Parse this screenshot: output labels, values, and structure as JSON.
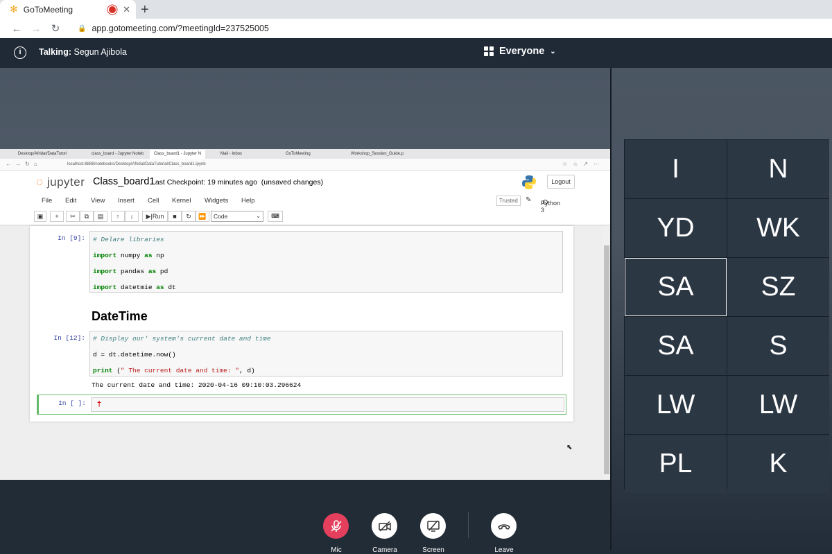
{
  "browser": {
    "tab_title": "GoToMeeting",
    "new_tab": "+",
    "url": "app.gotomeeting.com/?meetingId=237525005"
  },
  "meeting": {
    "talking_label": "Talking:",
    "talking_name": "Segun Ajibola",
    "audience": "Everyone"
  },
  "shared_screen": {
    "tabs": [
      "Desktop/Afridat/DataTutori",
      "class_board - Jupyter Noteb",
      "Class_board1 - Jupyter N",
      "Mail - Inbox",
      "GoToMeeting",
      "Workshop_Session_Guide.p"
    ],
    "url": "localhost:8888/notebooks/Desktop/Afridat/DataTutorial/Class_board1.ipynb",
    "jupyter": {
      "logo": "jupyter",
      "notebook_name": "Class_board1",
      "checkpoint": "Last Checkpoint: 19 minutes ago",
      "unsaved": "(unsaved changes)",
      "logout": "Logout",
      "menu": [
        "File",
        "Edit",
        "View",
        "Insert",
        "Cell",
        "Kernel",
        "Widgets",
        "Help"
      ],
      "trusted": "Trusted",
      "kernel": "Python 3",
      "run_label": "Run",
      "cell_type": "Code",
      "cell1": {
        "prompt": "In [9]:",
        "comment": "# Delare libraries",
        "l2_kw": "import",
        "l2_mod": " numpy ",
        "l2_as": "as",
        "l2_alias": " np",
        "l3_kw": "import",
        "l3_mod": " pandas ",
        "l3_as": "as",
        "l3_alias": " pd",
        "l4_kw": "import",
        "l4_mod": " datetmie ",
        "l4_as": "as",
        "l4_alias": " dt"
      },
      "heading": "DateTime",
      "cell2": {
        "prompt": "In [12]:",
        "comment": "# Display our' system's current date and time",
        "line2": "d = dt.datetime.now()",
        "print_kw": "print",
        "print_open": " (",
        "print_str": "\" The current date and time: \"",
        "print_rest": ", d)"
      },
      "output": "The current date and time:  2020-04-16 09:10:03.296624",
      "cell3": {
        "prompt": "In [ ]:"
      }
    }
  },
  "participants": [
    "I",
    "N",
    "YD",
    "WK",
    "SA",
    "SZ",
    "SA",
    "S",
    "LW",
    "LW",
    "PL",
    "K"
  ],
  "controls": {
    "mic": "Mic",
    "camera": "Camera",
    "screen": "Screen",
    "leave": "Leave"
  },
  "colors": {
    "mic_muted": "#e53f5e",
    "header_bg": "#1f2a36",
    "tile_bg": "#2c3744"
  }
}
